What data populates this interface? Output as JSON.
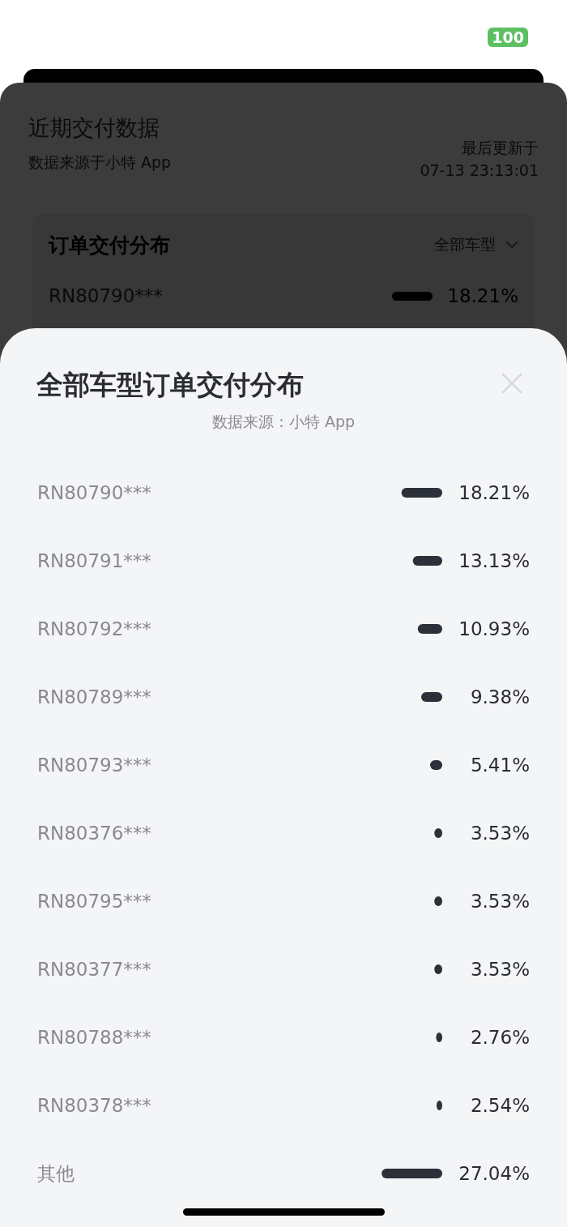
{
  "status_bar": {
    "battery": "100"
  },
  "background_panel": {
    "title": "近期交付数据",
    "source": "数据来源于小特 App",
    "updated_label": "最后更新于",
    "updated_time": "07-13 23:13:01",
    "card": {
      "title": "订单交付分布",
      "filter": "全部车型",
      "row": {
        "name": "RN80790***",
        "percent": "18.21%"
      }
    }
  },
  "sheet": {
    "title": "全部车型订单交付分布",
    "source": "数据来源：小特 App",
    "chart_data": {
      "type": "bar",
      "orientation": "horizontal",
      "value_labels": [
        "18.21%",
        "13.13%",
        "10.93%",
        "9.38%",
        "5.41%",
        "3.53%",
        "3.53%",
        "3.53%",
        "2.76%",
        "2.54%",
        "27.04%"
      ],
      "categories": [
        "RN80790***",
        "RN80791***",
        "RN80792***",
        "RN80789***",
        "RN80793***",
        "RN80376***",
        "RN80795***",
        "RN80377***",
        "RN80788***",
        "RN80378***",
        "其他"
      ],
      "values": [
        18.21,
        13.13,
        10.93,
        9.38,
        5.41,
        3.53,
        3.53,
        3.53,
        2.76,
        2.54,
        27.04
      ]
    }
  }
}
